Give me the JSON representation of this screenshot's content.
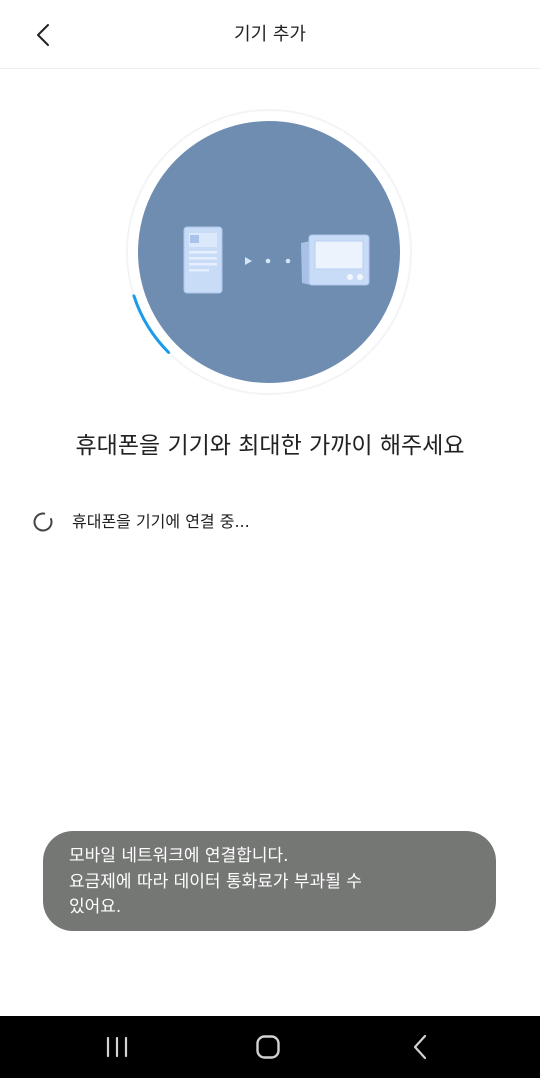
{
  "header": {
    "title": "기기 추가",
    "back_icon": "chevron-left-icon"
  },
  "illustration": {
    "phone_icon": "phone-icon",
    "connection_icon": "connection-dots-icon",
    "device_icon": "device-icon",
    "progress_icon": "progress-arc-icon"
  },
  "main": {
    "instruction": "휴대폰을 기기와 최대한 가까이 해주세요",
    "status": {
      "icon": "loading-spinner-icon",
      "text": "휴대폰을 기기에 연결 중..."
    }
  },
  "toast": {
    "lines": [
      "모바일 네트워크에 연결합니다.",
      "요금제에 따라 데이터 통화료가 부과될 수",
      "있어요."
    ]
  },
  "nav_bar": {
    "recent_icon": "recent-apps-icon",
    "home_icon": "home-icon",
    "back_icon": "back-icon"
  },
  "colors": {
    "circle": "#6e8db1",
    "progress": "#1b9be8",
    "toast_bg": "#757775",
    "nav_bar_bg": "#000000",
    "nav_icon": "#d2d2d2"
  }
}
